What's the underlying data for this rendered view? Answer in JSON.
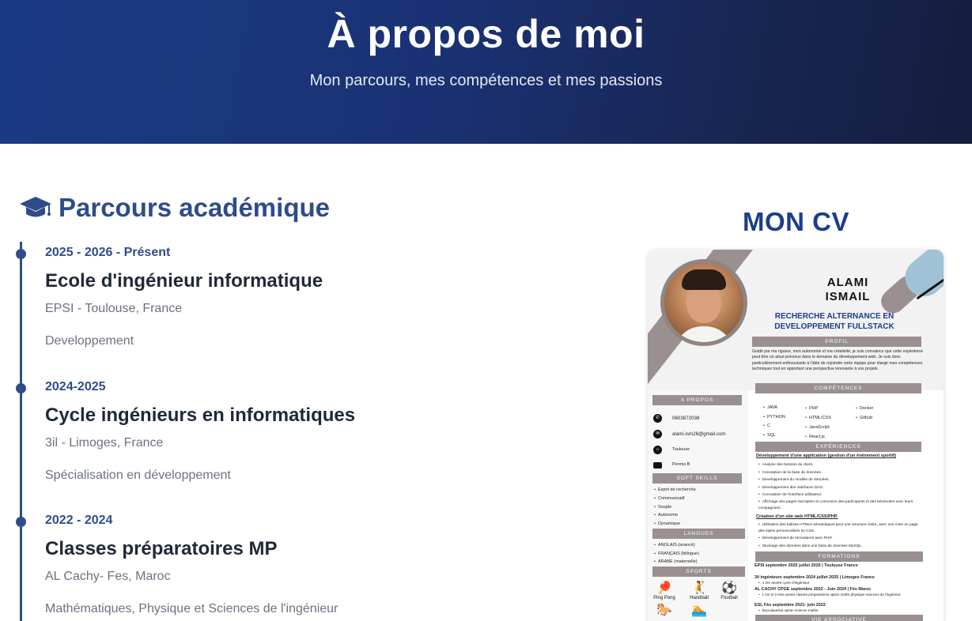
{
  "hero": {
    "title": "À propos de moi",
    "subtitle": "Mon parcours, mes compétences et mes passions"
  },
  "academic": {
    "title": "Parcours académique",
    "icon": "graduation-cap-icon",
    "items": [
      {
        "date": "2025 - 2026 - Présent",
        "title": "Ecole d'ingénieur informatique",
        "place": "EPSI - Toulouse, France",
        "desc": "Developpement"
      },
      {
        "date": "2024-2025",
        "title": "Cycle ingénieurs en informatiques",
        "place": "3il - Limoges, France",
        "desc": "Spécialisation en développement"
      },
      {
        "date": "2022 - 2024",
        "title": "Classes préparatoires MP",
        "place": "AL Cachy- Fes, Maroc",
        "desc": "Mathématiques, Physique et Sciences de l'ingénieur"
      }
    ]
  },
  "cv": {
    "heading": "MON CV",
    "name_line1": "ALAMI",
    "name_line2": "ISMAIL",
    "role": "RECHERCHE ALTERNANCE EN DEVELOPPEMENT FULLSTACK",
    "profil_title": "PROFIL",
    "profil_text": "Guidé par ma rigueur, mon autonomie et ma créativité, je suis convaincu que cette expérience peut être un atout précieux dans le domaine du développement web. Je suis donc particulièrement enthousiaste à l'idée de rejoindre votre équipe pour élargir mes compétences techniques tout en apportant une perspective innovante à vos projets.",
    "apropos_title": "A PROPOS",
    "contact": {
      "phone": "0603872038",
      "email": "alami.ism26@gmail.com",
      "city": "Toulouse",
      "permit": "Permis B"
    },
    "competences_title": "COMPÉTENCES",
    "skills_col1": [
      "JAVA",
      "PYTHON",
      "C",
      "SQL"
    ],
    "skills_col2": [
      "PHP",
      "HTML/CSS",
      "JavaScript",
      "React.js"
    ],
    "skills_col3": [
      "Docker",
      "Github"
    ],
    "softskills_title": "SOFT SKILLS",
    "softskills": [
      "Esprit de recherche",
      "Communicatif",
      "Souple",
      "Autonome",
      "Dynamique"
    ],
    "langues_title": "LANGUES",
    "langues": [
      "ANGLAIS (avancé)",
      "FRANÇAIS (bilingue)",
      "ARABE (maternelle)"
    ],
    "sports_title": "SPORTS",
    "sports": [
      "Ping Pong",
      "Handball",
      "Football"
    ],
    "experiences_title": "EXPÉRIENCES",
    "exp1_title": "Développement d'une application (gestion d'un événement sportif)",
    "exp1_items": [
      "Analyse des besoins du client.",
      "Conception de la base de données.",
      "Développement du modèle de données.",
      "Développement des interfaces DAO.",
      "Conception de l'interface utilisateur.",
      "Affichage des pages inscription et connexion des participants et des bénévoles avec leurs compagnons."
    ],
    "exp2_title": "Création d'un site web HTML/CSS/PHP.",
    "exp2_items": [
      "Utilisation des balises HTML5 sémantiques pour une structure claire, avec une mise en page des styles personnalisés en CSS.",
      "Développement de formulaires avec PHP.",
      "Stockage des données dans une base de données MySQL."
    ],
    "formations_title": "FORMATIONS",
    "formations": [
      {
        "title": "EPSI septembre 2025 juillet 2026 | Toulouse France",
        "detail": ""
      },
      {
        "title": "3il ingénieurs septembre 2024 juillet 2025 | Limoges France",
        "detail": "1 ère année cycle d'ingénieur"
      },
      {
        "title": "AL CACHY CPGE septembre 2022 - Juin 2024 | Fès Maroc",
        "detail": "1 ere et 2 éme année classes préparatoires option maths physique sciences de l'ingénieur"
      },
      {
        "title": "ESL Fès septembre 2021- juin 2022",
        "detail": "baccalauréat option science maths"
      }
    ],
    "vie_title": "VIE ASSOCIATIVE"
  }
}
